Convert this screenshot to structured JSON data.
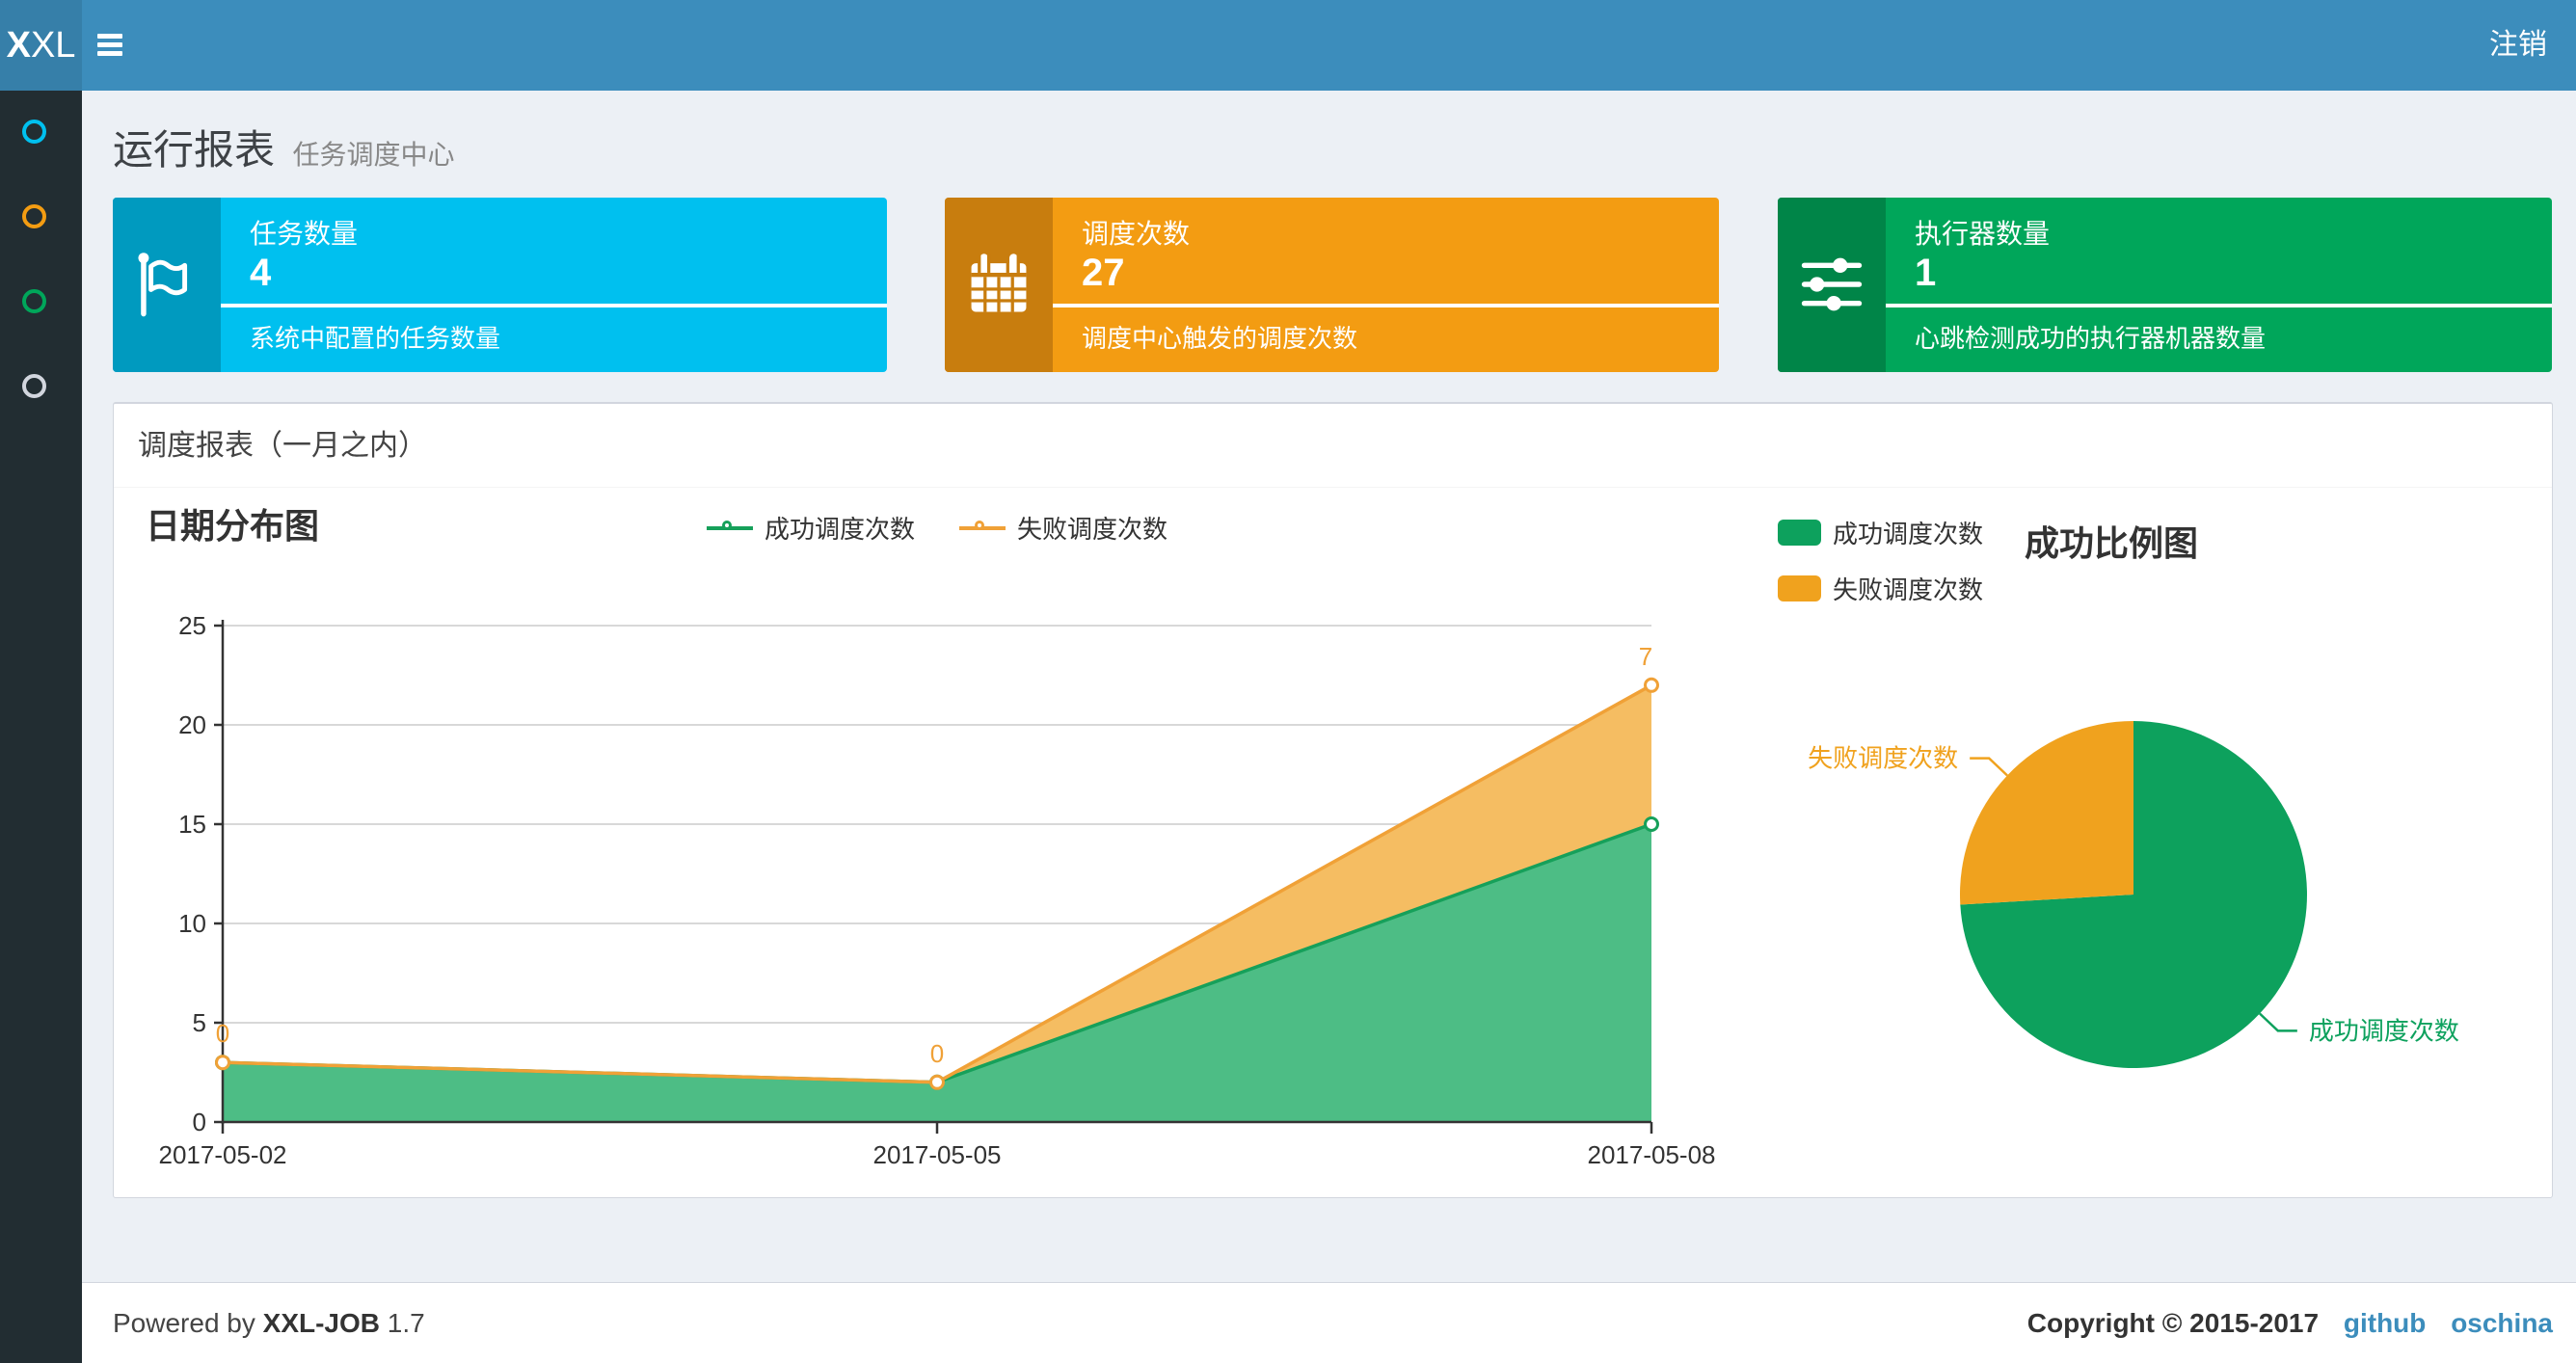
{
  "navbar": {
    "logo_bold": "X",
    "logo_rest": "XL",
    "logout_label": "注销"
  },
  "sidebar": {
    "items": [
      {
        "icon": "circle-icon",
        "color": "#00c0ef"
      },
      {
        "icon": "circle-icon",
        "color": "#f39c12"
      },
      {
        "icon": "circle-icon",
        "color": "#00a65a"
      },
      {
        "icon": "circle-icon",
        "color": "#d2d6de"
      }
    ]
  },
  "page_header": {
    "title": "运行报表",
    "subtitle": "任务调度中心"
  },
  "stat_cards": [
    {
      "title": "任务数量",
      "value": "4",
      "description": "系统中配置的任务数量",
      "color": "#00c0ef",
      "icon_bg": "#009abf",
      "icon": "flag-icon"
    },
    {
      "title": "调度次数",
      "value": "27",
      "description": "调度中心触发的调度次数",
      "color": "#f39c12",
      "icon_bg": "#c87d0e",
      "icon": "calendar-icon"
    },
    {
      "title": "执行器数量",
      "value": "1",
      "description": "心跳检测成功的执行器机器数量",
      "color": "#00a65a",
      "icon_bg": "#008548",
      "icon": "sliders-icon"
    }
  ],
  "report_panel": {
    "title": "调度报表（一月之内）"
  },
  "chart_data": [
    {
      "type": "area",
      "title": "日期分布图",
      "categories": [
        "2017-05-02",
        "2017-05-05",
        "2017-05-08"
      ],
      "series": [
        {
          "name": "成功调度次数",
          "values": [
            3,
            2,
            15
          ],
          "color": "#16a05a",
          "fill": "#4dbd85"
        },
        {
          "name": "失败调度次数",
          "values": [
            0,
            0,
            7
          ],
          "color": "#f0a137",
          "fill": "#f5bd62",
          "point_labels": [
            "0",
            "0",
            "7"
          ]
        }
      ],
      "stacked": true,
      "ylim": [
        0,
        25
      ],
      "ytick_step": 5,
      "yticks": [
        "0",
        "5",
        "10",
        "15",
        "20",
        "25"
      ],
      "grid": true,
      "legend_position": "top-center"
    },
    {
      "type": "pie",
      "title": "成功比例图",
      "slices": [
        {
          "name": "成功调度次数",
          "value": 20,
          "color": "#0da15d"
        },
        {
          "name": "失败调度次数",
          "value": 7,
          "color": "#f0a21e"
        }
      ],
      "legend_position": "top-left",
      "labels": "leader-lines"
    }
  ],
  "footer": {
    "powered_prefix": "Powered by",
    "product": "XXL-JOB",
    "version": "1.7",
    "copyright": "Copyright © 2015-2017",
    "links": [
      {
        "label": "github"
      },
      {
        "label": "oschina"
      }
    ]
  }
}
